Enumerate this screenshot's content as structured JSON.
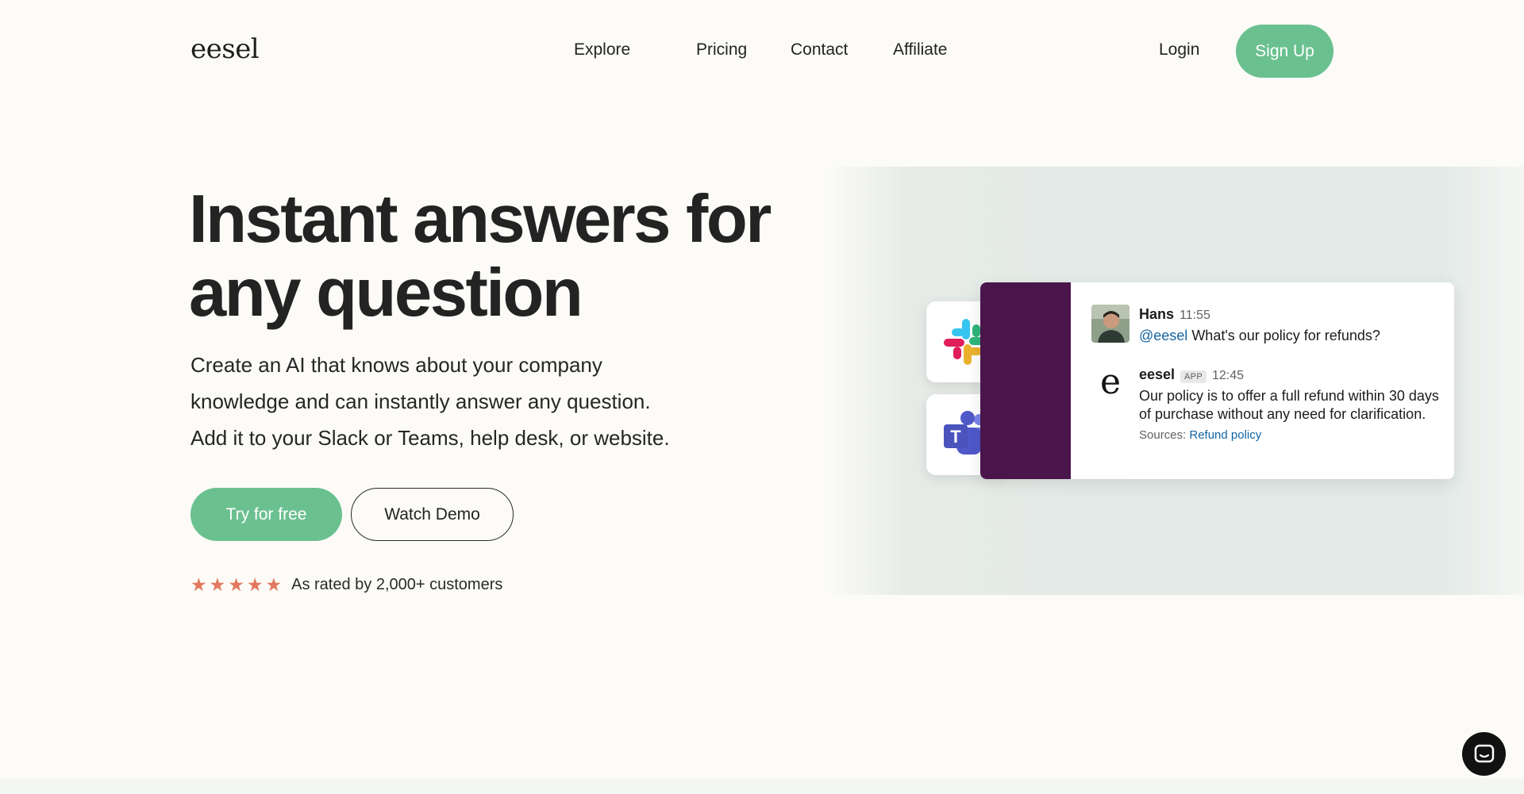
{
  "nav": {
    "logo": "eesel",
    "links": [
      "Explore",
      "Pricing",
      "Contact",
      "Affiliate"
    ],
    "login": "Login",
    "signup": "Sign Up"
  },
  "hero": {
    "title_line1": "Instant answers for",
    "title_line2": "any question",
    "desc_line1": "Create an AI that knows about your company",
    "desc_line2": "knowledge and can instantly answer any question.",
    "desc_line3": "Add it to your Slack or Teams, help desk, or website.",
    "cta_primary": "Try for free",
    "cta_secondary": "Watch Demo",
    "rating_stars": 5,
    "rating_text": "As rated by 2,000+ customers"
  },
  "chat": {
    "message1": {
      "name": "Hans",
      "time": "11:55",
      "mention": "@eesel",
      "text": " What's our policy for refunds?"
    },
    "message2": {
      "name": "eesel",
      "badge": "APP",
      "time": "12:45",
      "text": "Our policy is to offer a full refund within 30 days of purchase without any need for clarification.",
      "sources_label": "Sources: ",
      "sources_link": "Refund policy"
    }
  },
  "colors": {
    "accent": "#6ac08f",
    "slack_sidebar": "#4a154b",
    "star": "#e2785d",
    "link": "#1264a3"
  },
  "icons": [
    "slack-logo-icon",
    "teams-logo-icon",
    "star-icon",
    "chat-bubble-icon"
  ]
}
